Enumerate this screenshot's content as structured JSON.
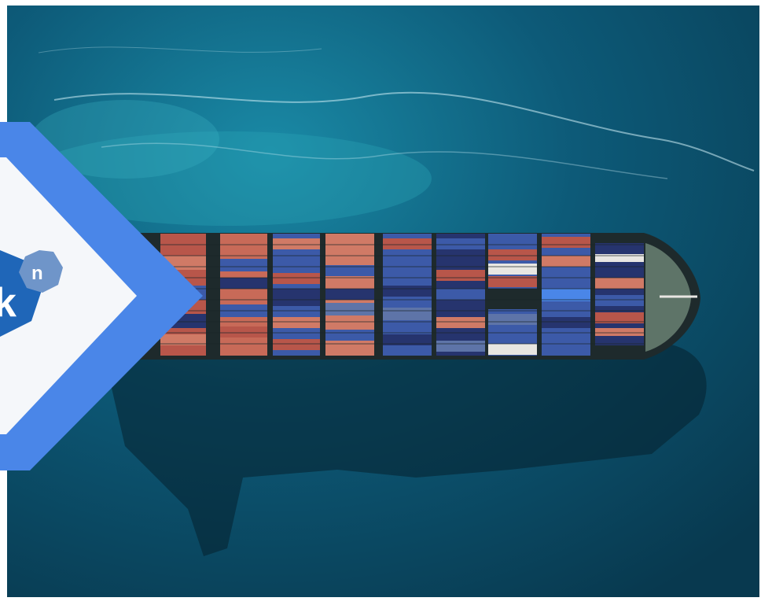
{
  "image": {
    "subject": "aerial-container-ship",
    "colors": {
      "sea_deep": "#08394f",
      "sea_mid": "#0d5a78",
      "sea_light": "#1a8aa6",
      "hull": "#1e2a2c",
      "deck": "#5e7468",
      "container_red": "#b8564a",
      "container_salmon": "#d07a66",
      "container_blue": "#3c5aa8",
      "container_navy": "#26346e",
      "container_white": "#e8e6e2",
      "shadow": "#05202e"
    }
  },
  "badge": {
    "shape": "chevron",
    "colors": {
      "outer": "#4a86e8",
      "inner": "#f5f7fa",
      "logo_dark": "#1f66b8",
      "logo_light": "#6f95c9"
    },
    "logo": {
      "main_letter": "k",
      "small_letter": "n"
    }
  }
}
